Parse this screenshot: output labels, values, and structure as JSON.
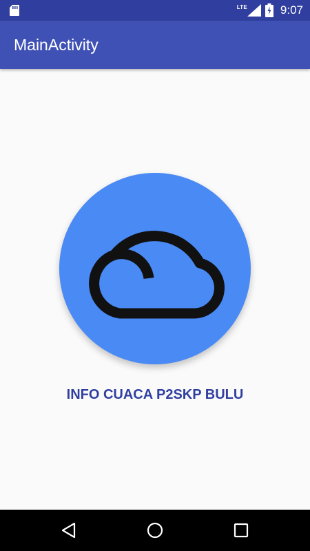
{
  "status_bar": {
    "time": "9:07",
    "network_label": "LTE",
    "icons": [
      "sd-card-icon",
      "lte-signal-icon",
      "battery-charging-icon"
    ]
  },
  "app_bar": {
    "title": "MainActivity"
  },
  "main": {
    "logo_icon": "cloud-icon",
    "logo_color": "#4a8af4",
    "label": "INFO CUACA P2SKP BULU"
  },
  "nav_bar": {
    "icons": [
      "back-icon",
      "home-icon",
      "recents-icon"
    ]
  },
  "colors": {
    "primary": "#3f51b5",
    "primary_dark": "#303f9f",
    "background": "#fafafa"
  }
}
